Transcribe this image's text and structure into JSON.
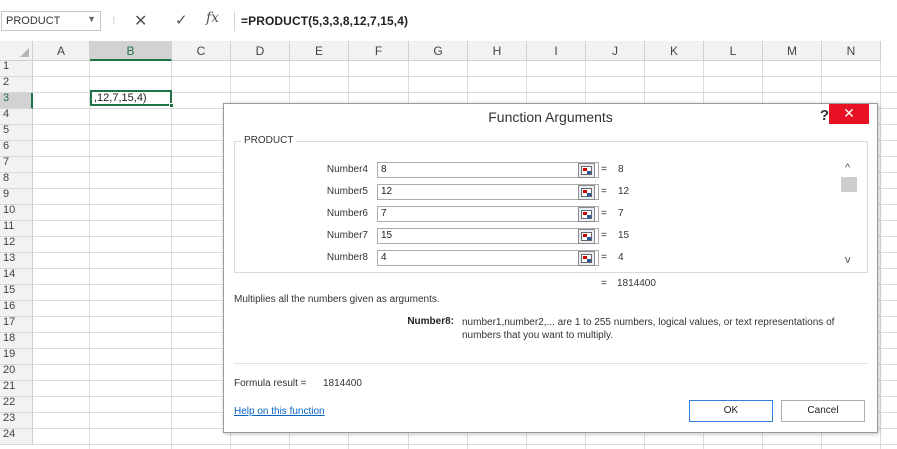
{
  "formula_bar": {
    "name_box": "PRODUCT",
    "separator": "⁝",
    "cancel_symbol": "✕",
    "enter_symbol": "✓",
    "fx_symbol": "fx",
    "formula": "=PRODUCT(5,3,3,8,12,7,15,4)"
  },
  "sheet": {
    "columns": [
      "A",
      "B",
      "C",
      "D",
      "E",
      "F",
      "G",
      "H",
      "I",
      "J",
      "K",
      "L",
      "M",
      "N"
    ],
    "rows": [
      "1",
      "2",
      "3",
      "4",
      "5",
      "6",
      "7",
      "8",
      "9",
      "10",
      "11",
      "12",
      "13",
      "14",
      "15",
      "16",
      "17",
      "18",
      "19",
      "20",
      "21",
      "22",
      "23",
      "24"
    ],
    "selected_column": "B",
    "selected_row": "3",
    "active_cell_text": ",12,7,15,4)"
  },
  "dialog": {
    "title": "Function Arguments",
    "help": "?",
    "close": "✕",
    "group_label": "PRODUCT",
    "arguments": [
      {
        "label": "Number4",
        "value": "8",
        "eq": "=",
        "result": "8"
      },
      {
        "label": "Number5",
        "value": "12",
        "eq": "=",
        "result": "12"
      },
      {
        "label": "Number6",
        "value": "7",
        "eq": "=",
        "result": "7"
      },
      {
        "label": "Number7",
        "value": "15",
        "eq": "=",
        "result": "15"
      },
      {
        "label": "Number8",
        "value": "4",
        "eq": "=",
        "result": "4"
      }
    ],
    "scroll_up": "^",
    "scroll_down": "v",
    "total_eq": "=",
    "total_value": "1814400",
    "description": "Multiplies all the numbers given as arguments.",
    "arg_name": "Number8:",
    "arg_description": "number1,number2,... are 1 to 255 numbers, logical values, or text representations of numbers that you want to multiply.",
    "formula_result_label": "Formula result =",
    "formula_result_value": "1814400",
    "help_link": "Help on this function",
    "ok_label": "OK",
    "cancel_label": "Cancel"
  }
}
